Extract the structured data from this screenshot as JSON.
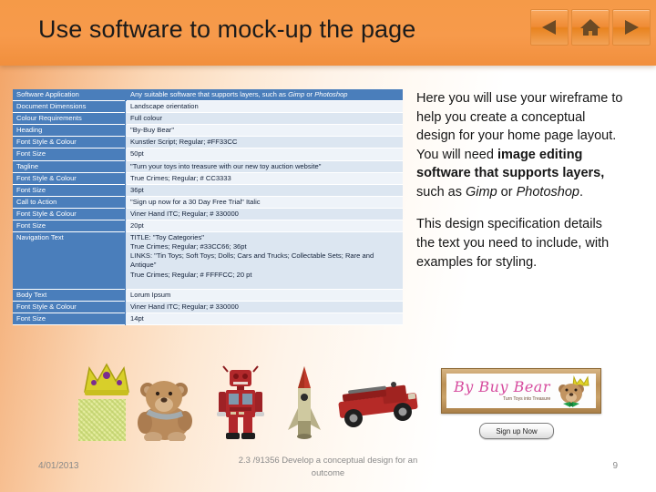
{
  "header": {
    "title": "Use software to mock-up the page",
    "nav": [
      {
        "name": "back-button",
        "label": "Back"
      },
      {
        "name": "home-button",
        "label": "Home"
      },
      {
        "name": "forward-button",
        "label": "Forward"
      }
    ]
  },
  "spec_table": {
    "rows": [
      {
        "label": "Software Application",
        "value": "Any suitable software that supports layers, such as ",
        "value_italic": "Gimp",
        "value_mid": " or ",
        "value_italic2": "Photoshop",
        "style": "head"
      },
      {
        "label": "Document Dimensions",
        "value": "Landscape orientation",
        "style": "alt"
      },
      {
        "label": "Colour Requirements",
        "value": "Full colour",
        "style": ""
      },
      {
        "label": "Heading",
        "value": "\"By-Buy Bear\"",
        "style": "alt"
      },
      {
        "label": "Font Style & Colour",
        "value": "Kunstler Script; Regular; #FF33CC",
        "style": ""
      },
      {
        "label": "Font Size",
        "value": "50pt",
        "style": "alt"
      },
      {
        "label": "Tagline",
        "value": "\"Turn your toys into treasure with our new toy auction website\"",
        "style": ""
      },
      {
        "label": "Font Style & Colour",
        "value": "True Crimes; Regular; # CC3333",
        "style": "alt"
      },
      {
        "label": "Font Size",
        "value": "36pt",
        "style": ""
      },
      {
        "label": "Call to Action",
        "value": "\"Sign up now for a 30 Day Free Trial\" Italic",
        "style": "alt"
      },
      {
        "label": "Font Style & Colour",
        "value": "Viner Hand ITC; Regular; # 330000",
        "style": ""
      },
      {
        "label": "Font Size",
        "value": "20pt",
        "style": "alt"
      },
      {
        "label": "Navigation Text",
        "value": "TITLE: \"Toy Categories\"\nTrue Crimes; Regular; #33CC66; 36pt\nLINKS: \"Tin Toys; Soft Toys; Dolls; Cars and Trucks; Collectable Sets; Rare and Antique\"\nTrue Crimes; Regular; # FFFFCC; 20 pt",
        "style": "tall"
      },
      {
        "label": "Body Text",
        "value": "Lorum Ipsum",
        "style": "alt"
      },
      {
        "label": "Font Style & Colour",
        "value": "Viner Hand ITC; Regular; # 330000",
        "style": ""
      },
      {
        "label": "Font Size",
        "value": "14pt",
        "style": "alt"
      }
    ]
  },
  "explanation": {
    "para1_a": "Here you will use your wireframe to help you create a conceptual design for your home page layout.  You will need ",
    "para1_bold": "image editing software that supports layers,",
    "para1_b": " such as ",
    "para1_italic1": "Gimp",
    "para1_c": " or ",
    "para1_italic2": "Photoshop",
    "para1_d": ".",
    "para2": "This design specification details the text you need to include, with examples for styling."
  },
  "toys": [
    {
      "name": "crown-image",
      "alt": "Gold crown"
    },
    {
      "name": "colour-swatch",
      "alt": "Yellow-green texture swatch"
    },
    {
      "name": "teddy-bear-image",
      "alt": "Brown teddy bear"
    },
    {
      "name": "robot-toy-image",
      "alt": "Red tin robot"
    },
    {
      "name": "rocket-toy-image",
      "alt": "Tin rocket"
    },
    {
      "name": "fire-truck-image",
      "alt": "Red tin fire truck"
    }
  ],
  "banner": {
    "title": "By Buy Bear",
    "tagline": "Turn Toys into Treasure",
    "signup_label": "Sign up Now"
  },
  "footer": {
    "date": "4/01/2013",
    "center": "2.3 /91356 Develop a conceptual design for an outcome",
    "page": "9"
  },
  "colors": {
    "header_orange": "#f79a4b",
    "table_blue": "#4a7ebb",
    "table_row_light": "#dce6f1",
    "table_row_lighter": "#eef3f9",
    "heading_pink": "#FF33CC",
    "tagline_red": "#CC3333",
    "nav_green": "#33CC66",
    "links_cream": "#FFFFCC",
    "body_brown": "#330000"
  }
}
